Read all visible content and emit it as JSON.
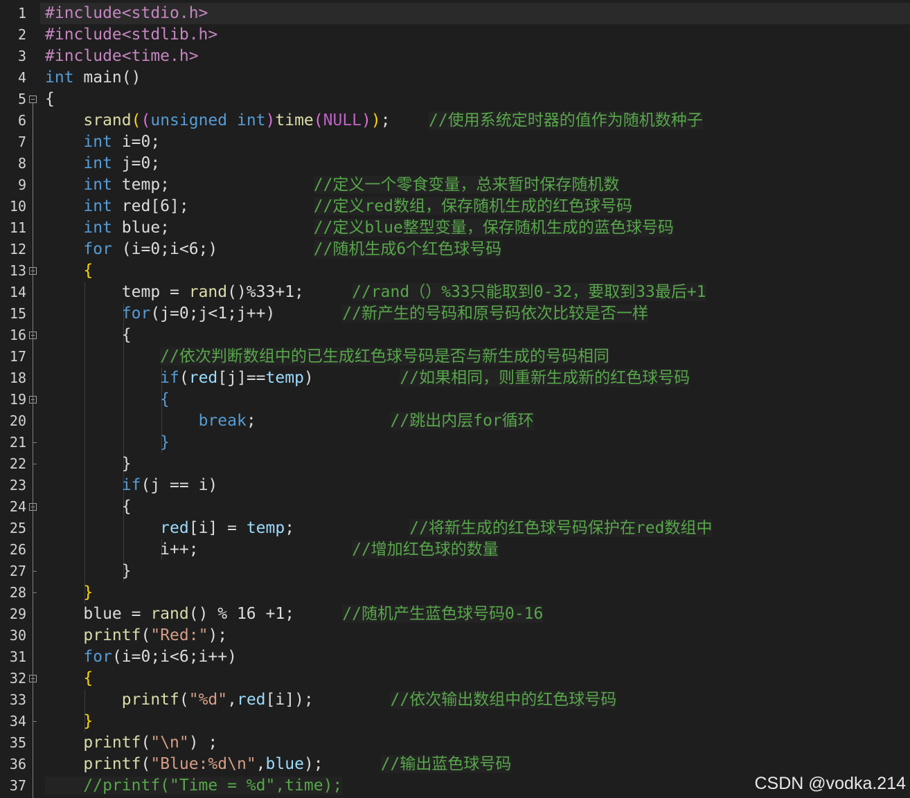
{
  "editor": {
    "line_numbers": [
      "1",
      "2",
      "3",
      "4",
      "5",
      "6",
      "7",
      "8",
      "9",
      "10",
      "11",
      "12",
      "13",
      "14",
      "15",
      "16",
      "17",
      "18",
      "19",
      "20",
      "21",
      "22",
      "23",
      "24",
      "25",
      "26",
      "27",
      "28",
      "29",
      "30",
      "31",
      "32",
      "33",
      "34",
      "35",
      "36",
      "37"
    ],
    "fold_markers_at_lines": [
      5,
      13,
      16,
      19,
      24,
      32
    ],
    "lines": [
      [
        {
          "t": "#include<stdio.h>",
          "c": "pp"
        }
      ],
      [
        {
          "t": "#include<stdlib.h>",
          "c": "pp"
        }
      ],
      [
        {
          "t": "#include<time.h>",
          "c": "pp"
        }
      ],
      [
        {
          "t": "int",
          "c": "kw"
        },
        {
          "t": " main()",
          "c": "id"
        }
      ],
      [
        {
          "t": "{",
          "c": "id"
        }
      ],
      [
        {
          "t": "    srand",
          "c": "fn"
        },
        {
          "t": "(",
          "c": "par"
        },
        {
          "t": "(",
          "c": "par2"
        },
        {
          "t": "unsigned",
          "c": "kw"
        },
        {
          "t": " ",
          "c": "id"
        },
        {
          "t": "int",
          "c": "kw"
        },
        {
          "t": ")",
          "c": "par2"
        },
        {
          "t": "time",
          "c": "fn"
        },
        {
          "t": "(",
          "c": "par2"
        },
        {
          "t": "NULL",
          "c": "mac"
        },
        {
          "t": ")",
          "c": "par2"
        },
        {
          "t": ")",
          "c": "par"
        },
        {
          "t": ";    ",
          "c": "id"
        },
        {
          "t": "//使用系统定时器的值作为随机数种子",
          "c": "cmt"
        }
      ],
      [
        {
          "t": "    ",
          "c": "id"
        },
        {
          "t": "int",
          "c": "kw"
        },
        {
          "t": " i=0;",
          "c": "id"
        }
      ],
      [
        {
          "t": "    ",
          "c": "id"
        },
        {
          "t": "int",
          "c": "kw"
        },
        {
          "t": " j=0;",
          "c": "id"
        }
      ],
      [
        {
          "t": "    ",
          "c": "id"
        },
        {
          "t": "int",
          "c": "kw"
        },
        {
          "t": " temp;               ",
          "c": "id"
        },
        {
          "t": "//定义一个零食变量，总来暂时保存随机数",
          "c": "cmt"
        }
      ],
      [
        {
          "t": "    ",
          "c": "id"
        },
        {
          "t": "int",
          "c": "kw"
        },
        {
          "t": " red[6];             ",
          "c": "id"
        },
        {
          "t": "//定义red数组，保存随机生成的红色球号码",
          "c": "cmt"
        }
      ],
      [
        {
          "t": "    ",
          "c": "id"
        },
        {
          "t": "int",
          "c": "kw"
        },
        {
          "t": " blue;               ",
          "c": "id"
        },
        {
          "t": "//定义blue整型变量，保存随机生成的蓝色球号码",
          "c": "cmt"
        }
      ],
      [
        {
          "t": "    ",
          "c": "id"
        },
        {
          "t": "for",
          "c": "kw"
        },
        {
          "t": " (i=0;i<6;)          ",
          "c": "id"
        },
        {
          "t": "//随机生成6个红色球号码",
          "c": "cmt"
        }
      ],
      [
        {
          "t": "    {",
          "c": "par"
        }
      ],
      [
        {
          "t": "        temp = ",
          "c": "id"
        },
        {
          "t": "rand",
          "c": "fn"
        },
        {
          "t": "()%33+1;     ",
          "c": "id"
        },
        {
          "t": "//rand（）%33只能取到0-32，要取到33最后+1",
          "c": "cmt"
        }
      ],
      [
        {
          "t": "        ",
          "c": "id"
        },
        {
          "t": "for",
          "c": "kw"
        },
        {
          "t": "(j=0;j<1;j++)       ",
          "c": "id"
        },
        {
          "t": "//新产生的号码和原号码依次比较是否一样",
          "c": "cmt"
        }
      ],
      [
        {
          "t": "        {",
          "c": "id"
        }
      ],
      [
        {
          "t": "            ",
          "c": "id"
        },
        {
          "t": "//依次判断数组中的已生成红色球号码是否与新生成的号码相同",
          "c": "cmt"
        }
      ],
      [
        {
          "t": "            ",
          "c": "id"
        },
        {
          "t": "if",
          "c": "kw"
        },
        {
          "t": "(",
          "c": "id"
        },
        {
          "t": "red",
          "c": "var"
        },
        {
          "t": "[j]==",
          "c": "id"
        },
        {
          "t": "temp",
          "c": "var"
        },
        {
          "t": ")         ",
          "c": "id"
        },
        {
          "t": "//如果相同，则重新生成新的红色球号码",
          "c": "cmt"
        }
      ],
      [
        {
          "t": "            {",
          "c": "kw"
        }
      ],
      [
        {
          "t": "                ",
          "c": "id"
        },
        {
          "t": "break",
          "c": "kw"
        },
        {
          "t": ";              ",
          "c": "id"
        },
        {
          "t": "//跳出内层for循环",
          "c": "cmt"
        }
      ],
      [
        {
          "t": "            }",
          "c": "kw"
        }
      ],
      [
        {
          "t": "        }",
          "c": "id"
        }
      ],
      [
        {
          "t": "        ",
          "c": "id"
        },
        {
          "t": "if",
          "c": "kw"
        },
        {
          "t": "(j == i)",
          "c": "id"
        }
      ],
      [
        {
          "t": "        {",
          "c": "id"
        }
      ],
      [
        {
          "t": "            ",
          "c": "id"
        },
        {
          "t": "red",
          "c": "var"
        },
        {
          "t": "[i] = ",
          "c": "id"
        },
        {
          "t": "temp",
          "c": "var"
        },
        {
          "t": ";            ",
          "c": "id"
        },
        {
          "t": "//将新生成的红色球号码保护在red数组中",
          "c": "cmt"
        }
      ],
      [
        {
          "t": "            i++;                ",
          "c": "id"
        },
        {
          "t": "//增加红色球的数量",
          "c": "cmt"
        }
      ],
      [
        {
          "t": "        }",
          "c": "id"
        }
      ],
      [
        {
          "t": "    }",
          "c": "par"
        }
      ],
      [
        {
          "t": "    blue = ",
          "c": "id"
        },
        {
          "t": "rand",
          "c": "fn"
        },
        {
          "t": "() % 16 +1;     ",
          "c": "id"
        },
        {
          "t": "//随机产生蓝色球号码0-16",
          "c": "cmt"
        }
      ],
      [
        {
          "t": "    printf",
          "c": "fn"
        },
        {
          "t": "(",
          "c": "id"
        },
        {
          "t": "\"Red:\"",
          "c": "str"
        },
        {
          "t": ");",
          "c": "id"
        }
      ],
      [
        {
          "t": "    ",
          "c": "id"
        },
        {
          "t": "for",
          "c": "kw"
        },
        {
          "t": "(i=0;i<6;i++)",
          "c": "id"
        }
      ],
      [
        {
          "t": "    {",
          "c": "par"
        }
      ],
      [
        {
          "t": "        printf",
          "c": "fn"
        },
        {
          "t": "(",
          "c": "id"
        },
        {
          "t": "\"%d\"",
          "c": "str"
        },
        {
          "t": ",",
          "c": "id"
        },
        {
          "t": "red",
          "c": "var"
        },
        {
          "t": "[i]);        ",
          "c": "id"
        },
        {
          "t": "//依次输出数组中的红色球号码",
          "c": "cmt"
        }
      ],
      [
        {
          "t": "    }",
          "c": "par"
        }
      ],
      [
        {
          "t": "    printf",
          "c": "fn"
        },
        {
          "t": "(",
          "c": "id"
        },
        {
          "t": "\"\\n\"",
          "c": "str"
        },
        {
          "t": ") ;",
          "c": "id"
        }
      ],
      [
        {
          "t": "    printf",
          "c": "fn"
        },
        {
          "t": "(",
          "c": "id"
        },
        {
          "t": "\"Blue:%d\\n\"",
          "c": "str"
        },
        {
          "t": ",",
          "c": "id"
        },
        {
          "t": "blue",
          "c": "var"
        },
        {
          "t": ");      ",
          "c": "id"
        },
        {
          "t": "//输出蓝色球号码",
          "c": "cmt"
        }
      ],
      [
        {
          "t": "    //printf(\"Time = %d\",time);",
          "c": "cmt"
        }
      ]
    ]
  },
  "watermark": "CSDN @vodka.214"
}
